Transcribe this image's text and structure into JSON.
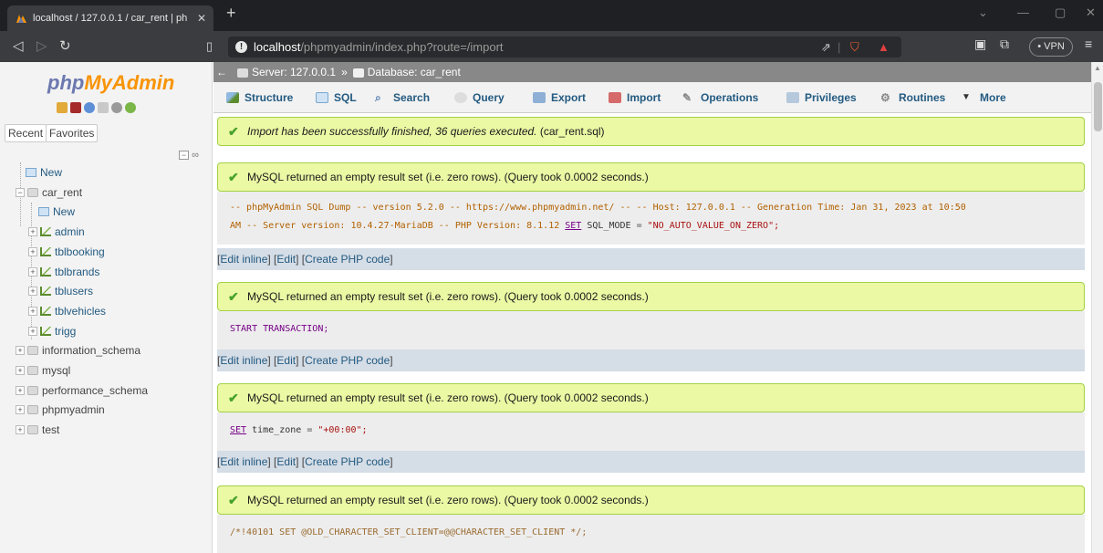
{
  "browser": {
    "tab_title": "localhost / 127.0.0.1 / car_rent | ph",
    "address_host": "localhost",
    "address_path": "/phpmyadmin/index.php?route=/import",
    "vpn_label": "• VPN"
  },
  "sidebar": {
    "logo_php": "php",
    "logo_myadmin": "MyAdmin",
    "recent_tab": "Recent",
    "favorites_tab": "Favorites",
    "tree": [
      {
        "label": "New",
        "level": "top",
        "icon": "new-icon"
      },
      {
        "label": "car_rent",
        "level": "db",
        "icon": "database-icon",
        "expanded": true
      },
      {
        "label": "New",
        "level": "child",
        "icon": "new-icon"
      },
      {
        "label": "admin",
        "level": "table",
        "icon": "table-icon"
      },
      {
        "label": "tblbooking",
        "level": "table",
        "icon": "table-icon"
      },
      {
        "label": "tblbrands",
        "level": "table",
        "icon": "table-icon"
      },
      {
        "label": "tblusers",
        "level": "table",
        "icon": "table-icon"
      },
      {
        "label": "tblvehicles",
        "level": "table",
        "icon": "table-icon"
      },
      {
        "label": "trigg",
        "level": "table",
        "icon": "table-icon"
      },
      {
        "label": "information_schema",
        "level": "db",
        "icon": "database-icon"
      },
      {
        "label": "mysql",
        "level": "db",
        "icon": "database-icon"
      },
      {
        "label": "performance_schema",
        "level": "db",
        "icon": "database-icon"
      },
      {
        "label": "phpmyadmin",
        "level": "db",
        "icon": "database-icon"
      },
      {
        "label": "test",
        "level": "db",
        "icon": "database-icon"
      }
    ]
  },
  "breadcrumb": {
    "server": "Server: 127.0.0.1",
    "separator": "»",
    "database": "Database: car_rent"
  },
  "menu": [
    {
      "label": "Structure",
      "icon": "structure-icon"
    },
    {
      "label": "SQL",
      "icon": "sql-icon"
    },
    {
      "label": "Search",
      "icon": "search-icon"
    },
    {
      "label": "Query",
      "icon": "query-icon"
    },
    {
      "label": "Export",
      "icon": "export-icon"
    },
    {
      "label": "Import",
      "icon": "import-icon"
    },
    {
      "label": "Operations",
      "icon": "operations-icon"
    },
    {
      "label": "Privileges",
      "icon": "privileges-icon"
    },
    {
      "label": "Routines",
      "icon": "routines-icon"
    },
    {
      "label": "More",
      "icon": "caret-down-icon"
    }
  ],
  "import_message": {
    "text": "Import has been successfully finished, 36 queries executed.",
    "file": "(car_rent.sql)"
  },
  "results": [
    {
      "message": "MySQL returned an empty result set (i.e. zero rows). (Query took 0.0002 seconds.)",
      "sql_line1_comment": "-- phpMyAdmin SQL Dump -- version 5.2.0 -- https://www.phpmyadmin.net/ -- -- Host: 127.0.0.1 -- Generation Time: Jan 31, 2023 at 10:50",
      "sql_line2_comment": "AM -- Server version: 10.4.27-MariaDB -- PHP Version: 8.1.12",
      "sql_kw": "SET",
      "sql_var": "SQL_MODE",
      "sql_eq": "=",
      "sql_str": "\"NO_AUTO_VALUE_ON_ZERO\";"
    },
    {
      "message": "MySQL returned an empty result set (i.e. zero rows). (Query took 0.0002 seconds.)",
      "sql": "START TRANSACTION;"
    },
    {
      "message": "MySQL returned an empty result set (i.e. zero rows). (Query took 0.0002 seconds.)",
      "sql_kw": "SET",
      "sql_var": "time_zone",
      "sql_eq": "=",
      "sql_str": "\"+00:00\";"
    },
    {
      "message": "MySQL returned an empty result set (i.e. zero rows). (Query took 0.0002 seconds.)",
      "sql": "/*!40101 SET @OLD_CHARACTER_SET_CLIENT=@@CHARACTER_SET_CLIENT */;"
    }
  ],
  "edit_links": {
    "open": "[",
    "edit_inline": "Edit inline",
    "mid1": "] [",
    "edit": "Edit",
    "mid2": "] [",
    "create_php": "Create PHP code",
    "close": "]"
  }
}
